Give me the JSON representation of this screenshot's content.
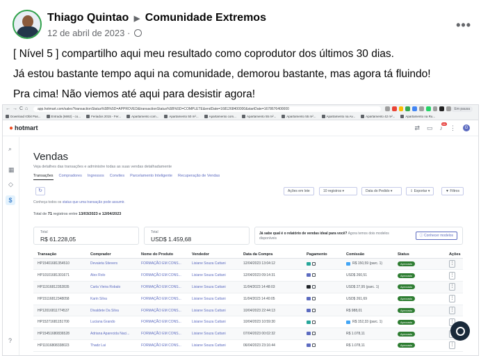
{
  "post": {
    "author": "Thiago Quintao",
    "group": "Comunidade Extremos",
    "date": "12 de abril de 2023",
    "separator": "·",
    "more": "•••",
    "paragraphs": [
      "[ Nível 5 ] compartilho aqui meu resultado como coprodutor dos últimos 30 dias.",
      "Já estou bastante tempo aqui na comunidade, demorou bastante, mas agora tá fluindo!",
      "Pra cima! Não viemos até aqui para desistir agora!"
    ]
  },
  "browser": {
    "url": "app.hotmart.com/sales?transactionStatus%5B%5D=APPROVED&transactionStatus%5B%5D=COMPLETE&endDate=1681268400000&startDate=1678676400000",
    "profile": "Em pausa",
    "bookmarks": [
      "Download IObit Pas...",
      "Entrada (6692) - co...",
      "Feriados 2015 - Fer...",
      "Apartamento com...",
      "Apartamento 50 m²...",
      "Apartamento com...",
      "Apartamento 55 m²...",
      "Apartamento 55 m²...",
      "Apartamento na Av...",
      "Apartamento 42 m²...",
      "Apartamento na Ru..."
    ]
  },
  "app": {
    "brand": "hotmart",
    "notifications": "59",
    "user_initial": "G",
    "page_title": "Vendas",
    "page_subtitle": "Veja detalhes das transações e administre todas as suas vendas detalhadamente",
    "tabs": [
      "Transações",
      "Compradores",
      "Ingressos",
      "Convites",
      "Parcelamento Inteligente",
      "Recuperação de Vendas"
    ],
    "toolbar": {
      "bulk": "Ações em lote",
      "records": "10 registros",
      "order": "Data do Pedido",
      "export": "Exportar",
      "filters": "Filtros"
    },
    "hint_prefix": "Conheça todos os",
    "hint_link": "status que uma transação pode assumir.",
    "count_prefix": "Total de",
    "count_num": "71",
    "count_mid": "registros entre",
    "count_range": "13/03/2023 e 12/04/2023",
    "totals": [
      {
        "label": "Total",
        "value": "R$ 61.228,05"
      },
      {
        "label": "Total",
        "value": "USD$ 1.459,68"
      }
    ],
    "promo_bold": "Já sabe qual é o relatório de vendas ideal para você?",
    "promo_text": "Agora temos dois modelos disponíveis",
    "promo_button": "Conhecer modelos"
  },
  "table": {
    "headers": [
      "Transação",
      "Comprador",
      "Nome do Produto",
      "Vendedor",
      "Data da Compra",
      "Pagamento",
      "Comissão",
      "Status",
      "Ações"
    ],
    "rows": [
      {
        "id": "HP15401681354510",
        "buyer": "Devaieta Stievers",
        "product": "FORMAÇÃO EM CONS...",
        "seller": "Lisiane Souza Cattani",
        "date": "12/04/2023 13:04:12",
        "pay_color": "#26a69a",
        "commission": "R$ 150,59 (parc. 1)",
        "status": "Aprovado"
      },
      {
        "id": "HP10101681301671",
        "buyer": "Alex Rolo",
        "product": "FORMAÇÃO EM CONS...",
        "seller": "Lisiane Souza Cattani",
        "date": "12/04/2023 09:14:31",
        "pay_color": "#5c6bc0",
        "commission": "USD$ 260,51",
        "status": "Aprovado"
      },
      {
        "id": "HP11916812352835",
        "buyer": "Carla Vieira Robalo",
        "product": "FORMAÇÃO EM CONS...",
        "seller": "Lisiane Souza Cattani",
        "date": "11/04/2023 14:48:03",
        "pay_color": "#212529",
        "commission": "USD$ 27,95 (parc. 1)",
        "status": "Aprovado"
      },
      {
        "id": "HP15116812348058",
        "buyer": "Karin Silva",
        "product": "FORMAÇÃO EM CONS...",
        "seller": "Lisiane Souza Cattani",
        "date": "11/04/2023 14:40:05",
        "pay_color": "#5c6bc0",
        "commission": "USD$ 261,69",
        "status": "Aprovado"
      },
      {
        "id": "HP12016811774537",
        "buyer": "Divaldete Da Silva",
        "product": "FORMAÇÃO EM CONS...",
        "seller": "Lisiane Souza Cattani",
        "date": "10/04/2023 22:44:13",
        "pay_color": "#5c6bc0",
        "commission": "R$ 988,01",
        "status": "Aprovado"
      },
      {
        "id": "HP15271681151700",
        "buyer": "Luciana Grando",
        "product": "FORMAÇÃO EM CONS...",
        "seller": "Lisiane Souza Cattani",
        "date": "10/04/2023 10:59:30",
        "pay_color": "#26a69a",
        "commission": "R$ 152,33 (parc. 1)",
        "status": "Aprovado"
      },
      {
        "id": "HP15451680836528",
        "buyer": "Adriana Aparecida Naci...",
        "product": "FORMAÇÃO EM CONS...",
        "seller": "Lisiane Souza Cattani",
        "date": "07/04/2023 00:02:32",
        "pay_color": "#5c6bc0",
        "commission": "R$ 1.078,11",
        "status": "Aprovado"
      },
      {
        "id": "HP11916808338023",
        "buyer": "Thadz Lai",
        "product": "FORMAÇÃO EM CONS...",
        "seller": "Lisiane Souza Cattani",
        "date": "06/04/2023 23:16:44",
        "pay_color": "#5c6bc0",
        "commission": "R$ 1.078,11",
        "status": "Aprovado"
      }
    ]
  }
}
